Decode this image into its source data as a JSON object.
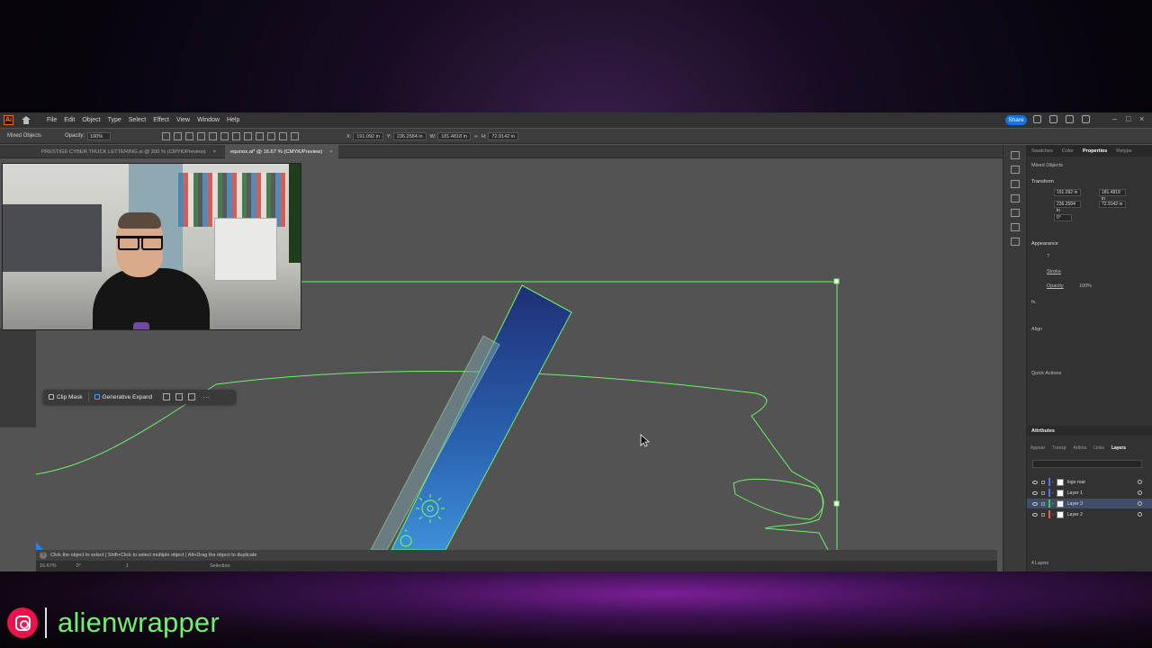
{
  "menubar": {
    "logo": "Ai",
    "items": [
      "File",
      "Edit",
      "Object",
      "Type",
      "Select",
      "Effect",
      "View",
      "Window",
      "Help"
    ],
    "share_label": "Share"
  },
  "control_bar": {
    "selection_label": "Mixed Objects",
    "opacity_label": "Opacity:",
    "opacity_value": "100%",
    "x_label": "X:",
    "x_value": "191.092 in",
    "y_label": "Y:",
    "y_value": "236.2584 in",
    "w_label": "W:",
    "w_value": "181.4818 in",
    "h_label": "H:",
    "h_value": "72.9142 in"
  },
  "tabs": [
    {
      "label": "PRESTIGE CYBER TRUCK LETTERING.ai @ 200 % (CMYK/Preview)"
    },
    {
      "label": "equnox.ai* @ 16.67 % (CMYK/Preview)"
    }
  ],
  "context_bar": {
    "clip_mask": "Clip Mask",
    "generative_expand": "Generative Expand",
    "more": "···"
  },
  "status": {
    "hint": "Click the object to select  |  Shift+Click to select multiple object  |  Alt+Drag the object to duplicate",
    "zoom": "16.67%",
    "rotation": "0°",
    "artboard": "1",
    "tool": "Selection"
  },
  "properties_panel": {
    "tabs": [
      "Swatches",
      "Color",
      "Properties",
      "Retype"
    ],
    "active_tab": "Properties",
    "object_type": "Mixed Objects",
    "transform_label": "Transform",
    "x_value": "191.092 in",
    "y_value": "236.2584 in",
    "w_value": "181.4818 in",
    "h_value": "72.9142 in",
    "angle_value": "0°",
    "appearance_label": "Appearance",
    "fill_value": "?",
    "stroke_label": "Stroke",
    "opacity_label": "Opacity",
    "opacity_value": "100%",
    "fx_label": "fx.",
    "align_label": "Align",
    "quick_actions_label": "Quick Actions"
  },
  "layers_panel": {
    "header": "Attributes",
    "tabs": [
      "Appear",
      "Transp",
      "Artboa",
      "Links",
      "Layers"
    ],
    "active_tab": "Layers",
    "layers": [
      {
        "name": "logo roar",
        "color": "#4f6fff",
        "selected": false
      },
      {
        "name": "Layer 1",
        "color": "#4f6fff",
        "selected": false
      },
      {
        "name": "Layer 3",
        "color": "#33cc55",
        "selected": true
      },
      {
        "name": "Layer 2",
        "color": "#ff4f4f",
        "selected": false
      }
    ],
    "count_label": "4 Layers"
  },
  "watermark": {
    "handle": "alienwrapper",
    "icon": "instagram-icon"
  },
  "colors": {
    "selection_green": "#6ef26c",
    "share_blue": "#1473e6",
    "canvas_gray": "#535353",
    "panel_dark": "#323232"
  }
}
